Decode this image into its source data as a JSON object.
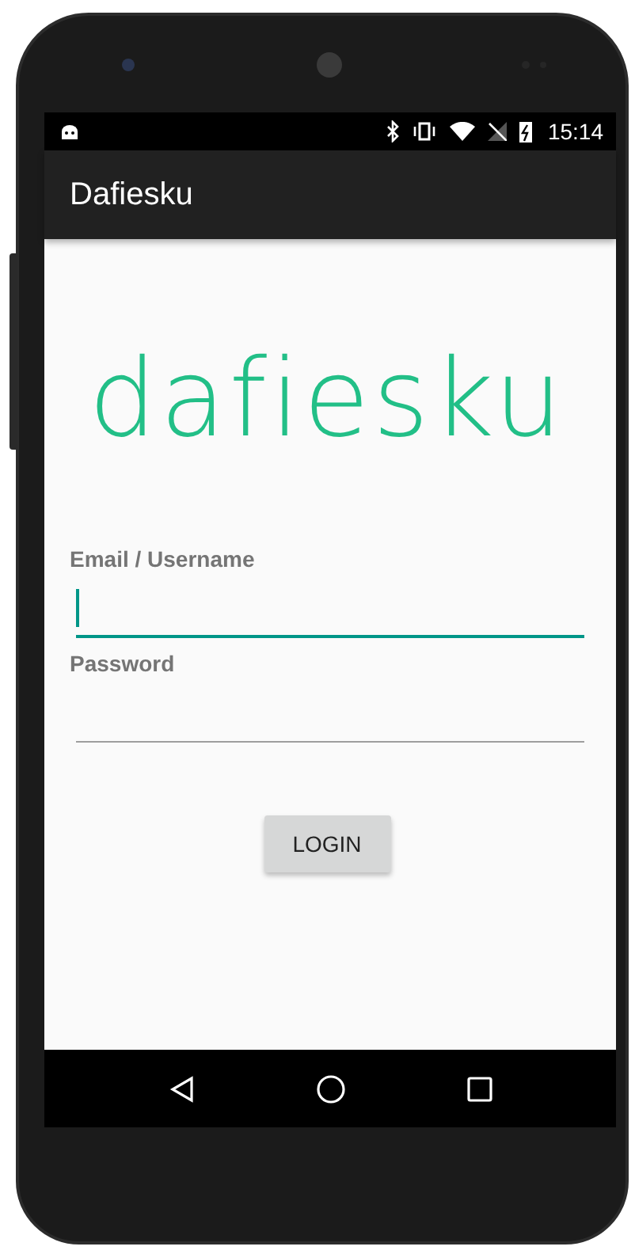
{
  "status_bar": {
    "time": "15:14"
  },
  "app_bar": {
    "title": "Dafiesku"
  },
  "logo": {
    "text": "dafiesku"
  },
  "form": {
    "fields": [
      {
        "label": "Email / Username",
        "focused": true
      },
      {
        "label": "Password",
        "focused": false
      }
    ],
    "button": "LOGIN"
  }
}
